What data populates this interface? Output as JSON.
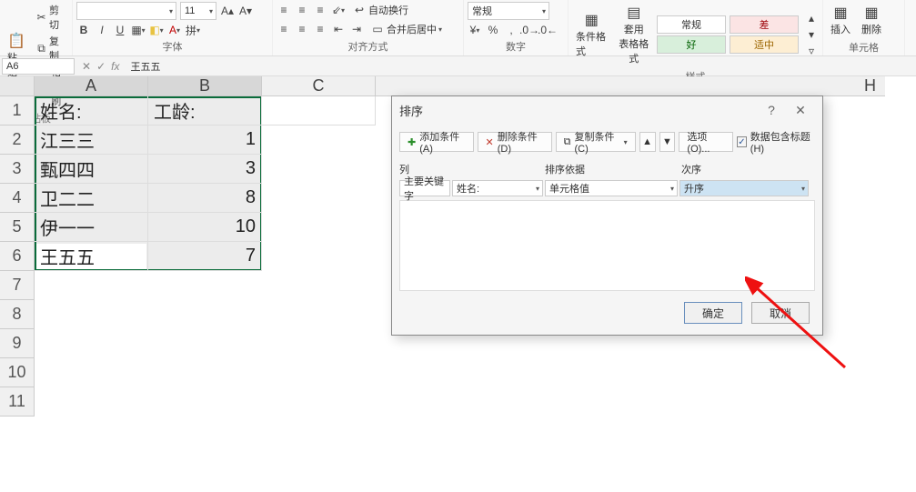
{
  "ribbon": {
    "clipboard": {
      "cut": "剪切",
      "copy": "复制",
      "paste": "粘贴",
      "formatPainter": "格式刷",
      "label": "剪贴板"
    },
    "font": {
      "name": "",
      "size": "11",
      "bold": "B",
      "italic": "I",
      "underline": "U",
      "label": "字体"
    },
    "alignment": {
      "wrap": "自动换行",
      "merge": "合并后居中",
      "label": "对齐方式"
    },
    "number": {
      "format": "常规",
      "label": "数字"
    },
    "styles": {
      "cond": "条件格式",
      "table": "套用\n表格格式",
      "normal": "常规",
      "bad": "差",
      "good": "好",
      "mid": "适中",
      "label": "样式"
    },
    "cells": {
      "insert": "插入",
      "delete": "删除",
      "label": "单元格"
    }
  },
  "formulaBar": {
    "name": "A6",
    "fx": "fx",
    "value": "王五五"
  },
  "columns": [
    "A",
    "B",
    "C",
    "H"
  ],
  "rowHeaders": [
    1,
    2,
    3,
    4,
    5,
    6,
    7,
    8,
    9,
    10,
    11
  ],
  "table": {
    "headers": {
      "a": "姓名:",
      "b": "工龄:"
    },
    "rows": [
      {
        "a": "江三三",
        "b": "1"
      },
      {
        "a": "甄四四",
        "b": "3"
      },
      {
        "a": "卫二二",
        "b": "8"
      },
      {
        "a": "伊一一",
        "b": "10"
      },
      {
        "a": "王五五",
        "b": "7"
      }
    ]
  },
  "dialog": {
    "title": "排序",
    "addCond": "添加条件(A)",
    "delCond": "删除条件(D)",
    "copyCond": "复制条件(C)",
    "options": "选项(O)...",
    "headerChk": "数据包含标题(H)",
    "colHeader": "列",
    "basisHeader": "排序依据",
    "orderHeader": "次序",
    "primaryKey": "主要关键字",
    "colValue": "姓名:",
    "basisValue": "单元格值",
    "orderValue": "升序",
    "ok": "确定",
    "cancel": "取消"
  },
  "chart_data": {
    "type": "table",
    "title": "",
    "columns": [
      "姓名:",
      "工龄:"
    ],
    "rows": [
      [
        "江三三",
        1
      ],
      [
        "甄四四",
        3
      ],
      [
        "卫二二",
        8
      ],
      [
        "伊一一",
        10
      ],
      [
        "王五五",
        7
      ]
    ]
  }
}
